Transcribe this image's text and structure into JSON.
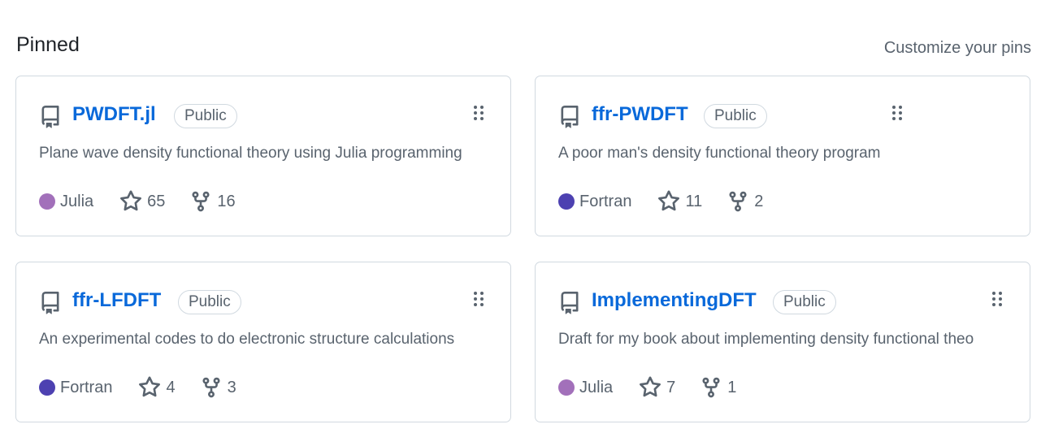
{
  "header": {
    "title": "Pinned",
    "customize_label": "Customize your pins"
  },
  "pins": [
    {
      "name": "PWDFT.jl",
      "visibility": "Public",
      "description": "Plane wave density functional theory using Julia programming",
      "language": "Julia",
      "language_color": "#a270ba",
      "stars": "65",
      "forks": "16"
    },
    {
      "name": "ffr-PWDFT",
      "visibility": "Public",
      "description": "A poor man's density functional theory program",
      "language": "Fortran",
      "language_color": "#4d41b1",
      "stars": "11",
      "forks": "2"
    },
    {
      "name": "ffr-LFDFT",
      "visibility": "Public",
      "description": "An experimental codes to do electronic structure calculations",
      "language": "Fortran",
      "language_color": "#4d41b1",
      "stars": "4",
      "forks": "3"
    },
    {
      "name": "ImplementingDFT",
      "visibility": "Public",
      "description": "Draft for my book about implementing density functional theo",
      "language": "Julia",
      "language_color": "#a270ba",
      "stars": "7",
      "forks": "1"
    }
  ],
  "colors": {
    "link": "#0969da",
    "muted": "#59636e",
    "border": "#d1d9e0"
  },
  "icons": {
    "repo": "repo-icon",
    "drag": "grabber-icon",
    "star": "star-icon",
    "fork": "repo-forked-icon"
  }
}
